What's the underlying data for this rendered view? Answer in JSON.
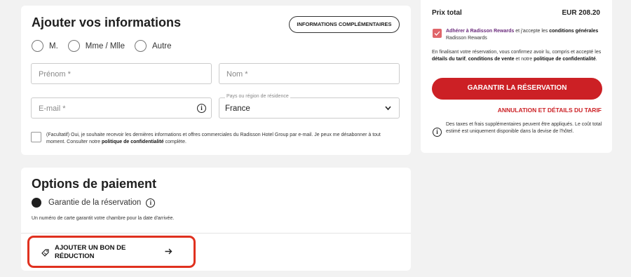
{
  "info": {
    "title": "Ajouter vos informations",
    "more_info_button": "INFORMATIONS COMPLÉMENTAIRES",
    "titles": [
      "M.",
      "Mme / Mlle",
      "Autre"
    ],
    "first_name_placeholder": "Prénom *",
    "last_name_placeholder": "Nom *",
    "email_placeholder": "E-mail *",
    "country_label": "Pays ou région de résidence",
    "country_value": "France",
    "newsletter_text_1": "(Facultatif) Oui, je souhaite recevoir les dernières informations et offres commerciales du Radisson Hotel Group par e-mail. Je peux me désabonner à tout moment. Consulter notre ",
    "newsletter_link": "politique de confidentialité",
    "newsletter_text_2": " complète."
  },
  "payment": {
    "title": "Options de paiement",
    "option_label": "Garantie de la réservation",
    "note": "Un numéro de carte garantit votre chambre pour la date d'arrivée.",
    "voucher_line1": "AJOUTER UN BON DE",
    "voucher_line2": "RÉDUCTION"
  },
  "summary": {
    "total_label": "Prix total",
    "total_value": "EUR 208.20",
    "rewards_link": "Adhérer à Radisson Rewards",
    "rewards_text": " et j'accepte les ",
    "rewards_conditions": "conditions générales",
    "rewards_suffix": " Radisson Rewards",
    "legal_1": "En finalisant votre réservation, vous confirmez avoir lu, compris et accepté les ",
    "legal_tariff": "détails du tarif",
    "legal_2": ", ",
    "legal_conditions": "conditions de vente",
    "legal_3": " et notre ",
    "legal_policy": "politique de confidentialité",
    "legal_4": ".",
    "submit_button": "GARANTIR LA RÉSERVATION",
    "cancel_link": "ANNULATION ET DÉTAILS DU TARIF",
    "taxes_note": "Des taxes et frais supplémentaires peuvent être appliqués. Le coût total estimé est uniquement disponible dans la devise de l'hôtel."
  },
  "colors": {
    "brand_red": "#cc2025",
    "highlight": "#e0311f",
    "rewards_purple": "#6a2a7b"
  }
}
